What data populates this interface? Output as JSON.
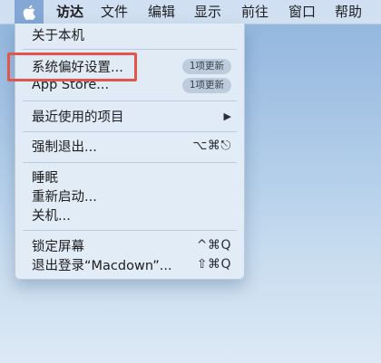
{
  "menubar": {
    "apple_icon": "apple-logo-icon",
    "items": [
      {
        "label": "访达",
        "bold": true
      },
      {
        "label": "文件"
      },
      {
        "label": "编辑"
      },
      {
        "label": "显示"
      },
      {
        "label": "前往"
      },
      {
        "label": "窗口"
      },
      {
        "label": "帮助"
      }
    ]
  },
  "apple_menu": {
    "about": {
      "label": "关于本机"
    },
    "system_prefs": {
      "label": "系统偏好设置...",
      "badge": "1项更新"
    },
    "app_store": {
      "label": "App Store...",
      "badge": "1项更新"
    },
    "recent_items": {
      "label": "最近使用的项目",
      "submenu_icon": "triangle-right-icon"
    },
    "force_quit": {
      "label": "强制退出...",
      "shortcut": "⌥⌘⎋"
    },
    "sleep": {
      "label": "睡眠"
    },
    "restart": {
      "label": "重新启动..."
    },
    "shutdown": {
      "label": "关机..."
    },
    "lock_screen": {
      "label": "锁定屏幕",
      "shortcut": "^⌘Q"
    },
    "logout": {
      "label": "退出登录“Macdown”...",
      "shortcut": "⇧⌘Q"
    }
  },
  "highlight_color": "#e2554a"
}
